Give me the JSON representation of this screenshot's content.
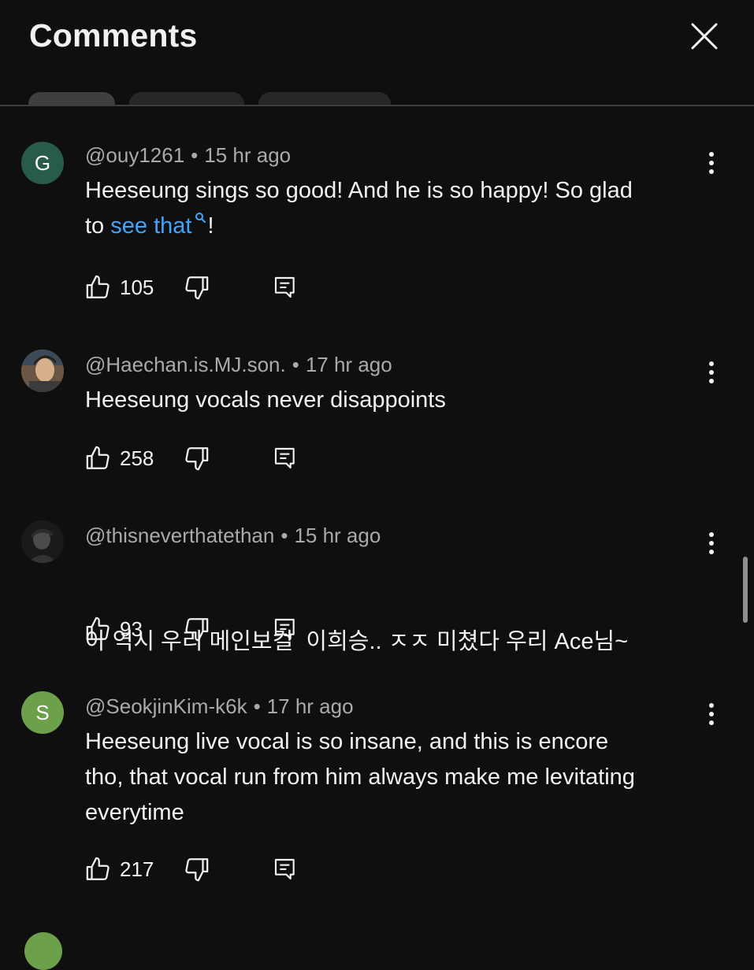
{
  "header": {
    "title": "Comments",
    "close_icon": "close-icon"
  },
  "colors": {
    "background": "#0f0f0f",
    "link": "#3ea6ff",
    "meta": "#aaaaaa",
    "avatar_green_dark": "#285b49",
    "avatar_green_light": "#6da04b"
  },
  "comments": [
    {
      "author": "@ouy1261",
      "time": "15 hr ago",
      "avatar_letter": "G",
      "text_lines": [
        "Heeseung sings so good! And he is so happy! So glad"
      ],
      "text_pre_link": "to ",
      "link_text": "see that",
      "text_post_link": "!",
      "likes": "105"
    },
    {
      "author": "@Haechan.is.MJ.son.",
      "time": "17 hr ago",
      "avatar_letter": "",
      "text_lines": [
        "Heeseung vocals never disappoints"
      ],
      "likes": "258"
    },
    {
      "author": "@thisneverthatethan",
      "time": "15 hr ago",
      "avatar_letter": "",
      "text_lines": [
        "아 역시 우리 메인보컬  이희승.. ㅈㅈ 미쳤다 우리 Ace님~"
      ],
      "likes": "93"
    },
    {
      "author": "@SeokjinKim-k6k",
      "time": "17 hr ago",
      "avatar_letter": "S",
      "text_lines": [
        "Heeseung live vocal is so insane, and this is encore",
        "tho, that vocal run from him always make me levitating",
        "everytime"
      ],
      "likes": "217"
    }
  ]
}
